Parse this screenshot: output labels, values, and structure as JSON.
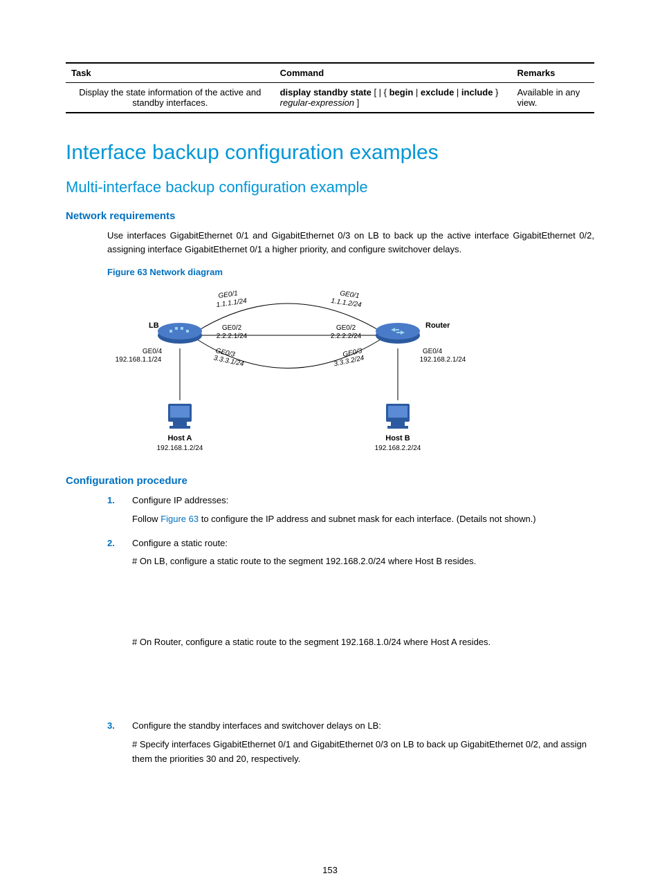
{
  "table": {
    "headers": [
      "Task",
      "Command",
      "Remarks"
    ],
    "row": {
      "task": "Display the state information of the active and standby interfaces.",
      "cmd_b1": "display standby state",
      "cmd_p1": " [ | { ",
      "cmd_b2": "begin",
      "cmd_p2": " | ",
      "cmd_b3": "exclude",
      "cmd_p3": " | ",
      "cmd_b4": "include",
      "cmd_p4": " } ",
      "cmd_i1": "regular-expression",
      "cmd_p5": " ]",
      "remarks": "Available in any view."
    }
  },
  "h1": "Interface backup configuration examples",
  "h2": "Multi-interface backup configuration example",
  "netreq_h": "Network requirements",
  "netreq_p": "Use interfaces GigabitEthernet 0/1 and GigabitEthernet 0/3 on LB to back up the active interface GigabitEthernet 0/2, assigning interface GigabitEthernet 0/1 a higher priority, and configure switchover delays.",
  "fig_caption": "Figure 63 Network diagram",
  "diagram": {
    "lb": "LB",
    "router": "Router",
    "hosta": "Host A",
    "hostb": "Host B",
    "lb_ge01": "GE0/1",
    "lb_ge01_ip": "1.1.1.1/24",
    "lb_ge02": "GE0/2",
    "lb_ge02_ip": "2.2.2.1/24",
    "lb_ge03": "GE0/3",
    "lb_ge03_ip": "3.3.3.1/24",
    "lb_ge04": "GE0/4",
    "lb_ge04_ip": "192.168.1.1/24",
    "r_ge01": "GE0/1",
    "r_ge01_ip": "1.1.1.2/24",
    "r_ge02": "GE0/2",
    "r_ge02_ip": "2.2.2.2/24",
    "r_ge03": "GE0/3",
    "r_ge03_ip": "3.3.3.2/24",
    "r_ge04": "GE0/4",
    "r_ge04_ip": "192.168.2.1/24",
    "hosta_ip": "192.168.1.2/24",
    "hostb_ip": "192.168.2.2/24"
  },
  "confproc_h": "Configuration procedure",
  "steps": {
    "s1": {
      "num": "1.",
      "title": "Configure IP addresses:",
      "p1a": "Follow ",
      "p1link": "Figure 63",
      "p1b": " to configure the IP address and subnet mask for each interface. (Details not shown.)"
    },
    "s2": {
      "num": "2.",
      "title": "Configure a static route:",
      "p1": "# On LB, configure a static route to the segment 192.168.2.0/24 where Host B resides.",
      "p2": "# On Router, configure a static route to the segment 192.168.1.0/24 where Host A resides."
    },
    "s3": {
      "num": "3.",
      "title": "Configure the standby interfaces and switchover delays on LB:",
      "p1": "# Specify interfaces GigabitEthernet 0/1 and GigabitEthernet 0/3 on LB to back up GigabitEthernet 0/2, and assign them the priorities 30 and 20, respectively."
    }
  },
  "page_num": "153"
}
